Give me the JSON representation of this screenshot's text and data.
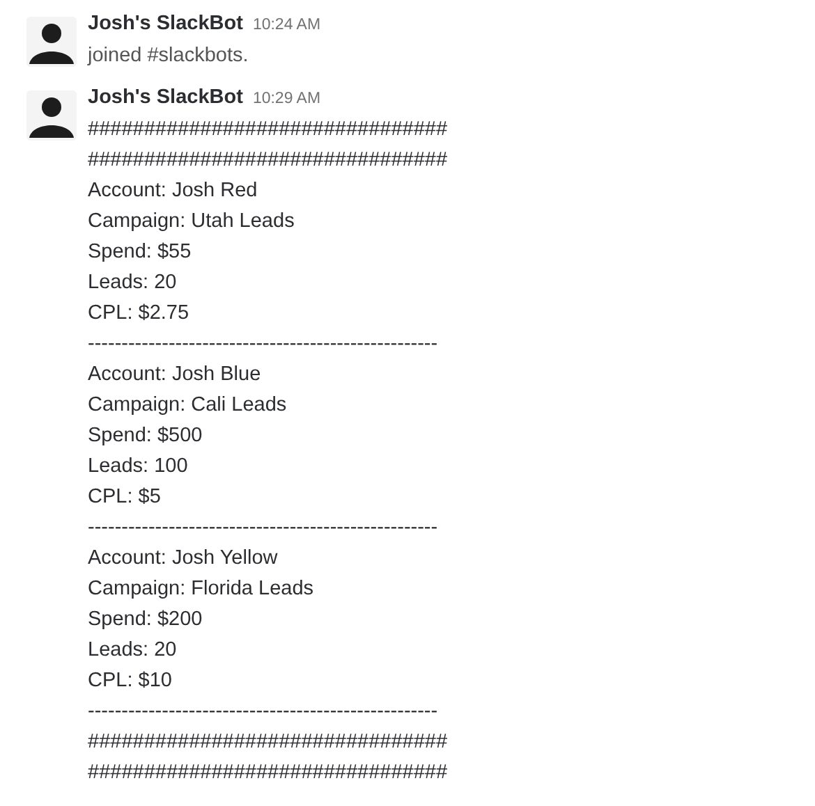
{
  "messages": [
    {
      "sender": "Josh's SlackBot",
      "time": "10:24 AM",
      "lines": [
        "joined #slackbots."
      ]
    },
    {
      "sender": "Josh's SlackBot",
      "time": "10:29 AM",
      "lines": [
        "################################",
        "################################",
        "Account: Josh Red",
        "Campaign: Utah Leads",
        "Spend: $55",
        "Leads: 20",
        "CPL: $2.75",
        "----------------------------------------------------",
        "Account: Josh Blue",
        "Campaign: Cali Leads",
        "Spend: $500",
        "Leads: 100",
        "CPL: $5",
        "----------------------------------------------------",
        "Account: Josh Yellow",
        "Campaign: Florida Leads",
        "Spend: $200",
        "Leads: 20",
        "CPL: $10",
        "----------------------------------------------------",
        "################################",
        "################################"
      ]
    }
  ]
}
